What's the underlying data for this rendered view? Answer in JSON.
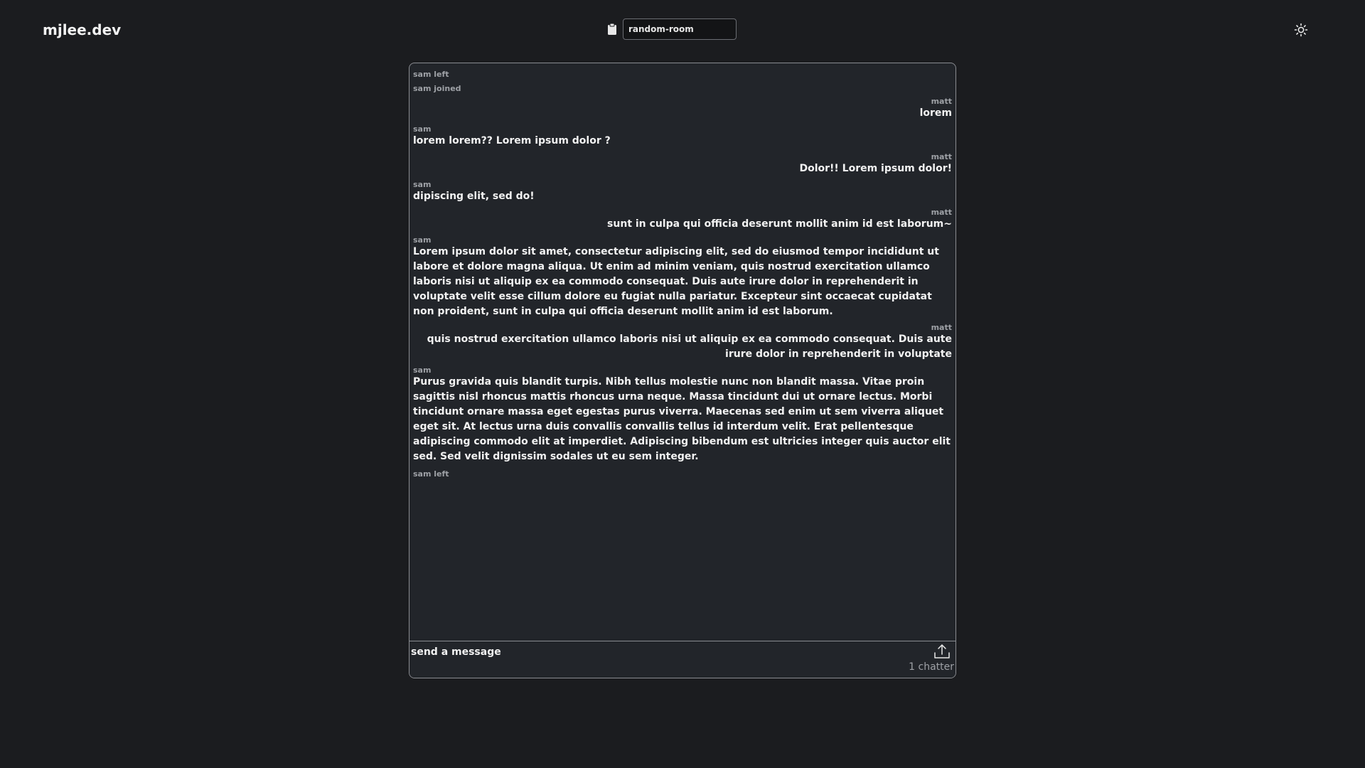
{
  "header": {
    "brand": "mjlee.dev",
    "room_value": "random-room",
    "icons": {
      "copy": "clipboard-icon",
      "theme": "sun-icon"
    }
  },
  "chat": {
    "messages": [
      {
        "type": "system",
        "text": "sam left"
      },
      {
        "type": "system",
        "text": "sam joined"
      },
      {
        "type": "message",
        "side": "right",
        "author": "matt",
        "text": "lorem"
      },
      {
        "type": "message",
        "side": "left",
        "author": "sam",
        "text": "lorem lorem?? Lorem ipsum dolor ?"
      },
      {
        "type": "message",
        "side": "right",
        "author": "matt",
        "text": "Dolor!! Lorem ipsum dolor!"
      },
      {
        "type": "message",
        "side": "left",
        "author": "sam",
        "text": "dipiscing elit, sed do!"
      },
      {
        "type": "message",
        "side": "right",
        "author": "matt",
        "text": "sunt in culpa qui officia deserunt mollit anim id est laborum~"
      },
      {
        "type": "message",
        "side": "left",
        "author": "sam",
        "text": "Lorem ipsum dolor sit amet, consectetur adipiscing elit, sed do eiusmod tempor incididunt ut labore et dolore magna aliqua. Ut enim ad minim veniam, quis nostrud exercitation ullamco laboris nisi ut aliquip ex ea commodo consequat. Duis aute irure dolor in reprehenderit in voluptate velit esse cillum dolore eu fugiat nulla pariatur. Excepteur sint occaecat cupidatat non proident, sunt in culpa qui officia deserunt mollit anim id est laborum."
      },
      {
        "type": "message",
        "side": "right",
        "author": "matt",
        "text": "quis nostrud exercitation ullamco laboris nisi ut aliquip ex ea commodo consequat. Duis aute irure dolor in reprehenderit in voluptate"
      },
      {
        "type": "message",
        "side": "left",
        "author": "sam",
        "text": "Purus gravida quis blandit turpis. Nibh tellus molestie nunc non blandit massa. Vitae proin sagittis nisl rhoncus mattis rhoncus urna neque. Massa tincidunt dui ut ornare lectus. Morbi tincidunt ornare massa eget egestas purus viverra. Maecenas sed enim ut sem viverra aliquet eget sit. At lectus urna duis convallis convallis tellus id interdum velit. Erat pellentesque adipiscing commodo elit at imperdiet. Adipiscing bibendum est ultricies integer quis auctor elit sed. Sed velit dignissim sodales ut eu sem integer."
      },
      {
        "type": "system",
        "text": "sam left"
      }
    ]
  },
  "composer": {
    "placeholder": "send a message",
    "chatter_count": "1 chatter",
    "icons": {
      "send": "upload-icon"
    }
  }
}
